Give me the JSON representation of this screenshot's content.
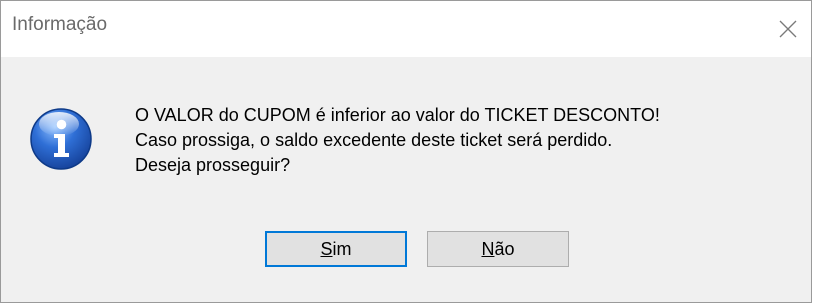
{
  "window": {
    "title": "Informação",
    "close_icon": "close-icon"
  },
  "icon": {
    "name": "information-icon",
    "color": "#1f5fc4"
  },
  "message": {
    "line1": "O VALOR do CUPOM é inferior ao valor do TICKET DESCONTO!",
    "line2": "Caso prossiga, o saldo excedente deste ticket será perdido.",
    "line3": "Deseja prosseguir?"
  },
  "buttons": {
    "yes": {
      "mnemonic": "S",
      "rest": "im",
      "label": "Sim"
    },
    "no": {
      "mnemonic": "N",
      "rest": "ão",
      "label": "Não"
    }
  },
  "colors": {
    "dialog_bg": "#f0f0f0",
    "titlebar_bg": "#ffffff",
    "default_button_border": "#0078d7",
    "button_bg": "#e1e1e1"
  }
}
